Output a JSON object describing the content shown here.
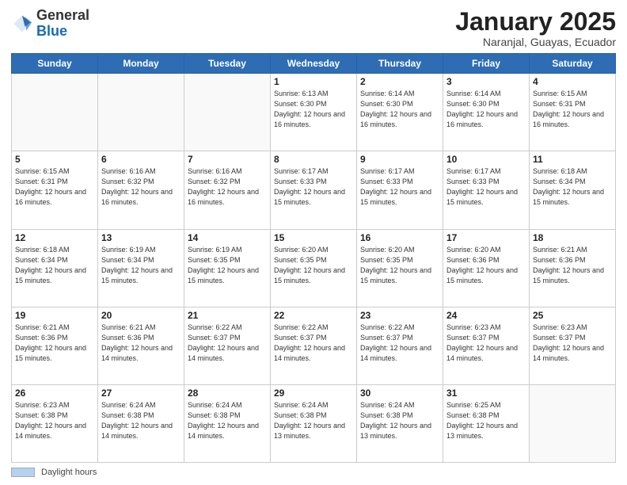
{
  "header": {
    "logo_general": "General",
    "logo_blue": "Blue",
    "month_title": "January 2025",
    "subtitle": "Naranjal, Guayas, Ecuador"
  },
  "days_of_week": [
    "Sunday",
    "Monday",
    "Tuesday",
    "Wednesday",
    "Thursday",
    "Friday",
    "Saturday"
  ],
  "weeks": [
    [
      {
        "day": "",
        "info": ""
      },
      {
        "day": "",
        "info": ""
      },
      {
        "day": "",
        "info": ""
      },
      {
        "day": "1",
        "info": "Sunrise: 6:13 AM\nSunset: 6:30 PM\nDaylight: 12 hours and 16 minutes."
      },
      {
        "day": "2",
        "info": "Sunrise: 6:14 AM\nSunset: 6:30 PM\nDaylight: 12 hours and 16 minutes."
      },
      {
        "day": "3",
        "info": "Sunrise: 6:14 AM\nSunset: 6:30 PM\nDaylight: 12 hours and 16 minutes."
      },
      {
        "day": "4",
        "info": "Sunrise: 6:15 AM\nSunset: 6:31 PM\nDaylight: 12 hours and 16 minutes."
      }
    ],
    [
      {
        "day": "5",
        "info": "Sunrise: 6:15 AM\nSunset: 6:31 PM\nDaylight: 12 hours and 16 minutes."
      },
      {
        "day": "6",
        "info": "Sunrise: 6:16 AM\nSunset: 6:32 PM\nDaylight: 12 hours and 16 minutes."
      },
      {
        "day": "7",
        "info": "Sunrise: 6:16 AM\nSunset: 6:32 PM\nDaylight: 12 hours and 16 minutes."
      },
      {
        "day": "8",
        "info": "Sunrise: 6:17 AM\nSunset: 6:33 PM\nDaylight: 12 hours and 15 minutes."
      },
      {
        "day": "9",
        "info": "Sunrise: 6:17 AM\nSunset: 6:33 PM\nDaylight: 12 hours and 15 minutes."
      },
      {
        "day": "10",
        "info": "Sunrise: 6:17 AM\nSunset: 6:33 PM\nDaylight: 12 hours and 15 minutes."
      },
      {
        "day": "11",
        "info": "Sunrise: 6:18 AM\nSunset: 6:34 PM\nDaylight: 12 hours and 15 minutes."
      }
    ],
    [
      {
        "day": "12",
        "info": "Sunrise: 6:18 AM\nSunset: 6:34 PM\nDaylight: 12 hours and 15 minutes."
      },
      {
        "day": "13",
        "info": "Sunrise: 6:19 AM\nSunset: 6:34 PM\nDaylight: 12 hours and 15 minutes."
      },
      {
        "day": "14",
        "info": "Sunrise: 6:19 AM\nSunset: 6:35 PM\nDaylight: 12 hours and 15 minutes."
      },
      {
        "day": "15",
        "info": "Sunrise: 6:20 AM\nSunset: 6:35 PM\nDaylight: 12 hours and 15 minutes."
      },
      {
        "day": "16",
        "info": "Sunrise: 6:20 AM\nSunset: 6:35 PM\nDaylight: 12 hours and 15 minutes."
      },
      {
        "day": "17",
        "info": "Sunrise: 6:20 AM\nSunset: 6:36 PM\nDaylight: 12 hours and 15 minutes."
      },
      {
        "day": "18",
        "info": "Sunrise: 6:21 AM\nSunset: 6:36 PM\nDaylight: 12 hours and 15 minutes."
      }
    ],
    [
      {
        "day": "19",
        "info": "Sunrise: 6:21 AM\nSunset: 6:36 PM\nDaylight: 12 hours and 15 minutes."
      },
      {
        "day": "20",
        "info": "Sunrise: 6:21 AM\nSunset: 6:36 PM\nDaylight: 12 hours and 14 minutes."
      },
      {
        "day": "21",
        "info": "Sunrise: 6:22 AM\nSunset: 6:37 PM\nDaylight: 12 hours and 14 minutes."
      },
      {
        "day": "22",
        "info": "Sunrise: 6:22 AM\nSunset: 6:37 PM\nDaylight: 12 hours and 14 minutes."
      },
      {
        "day": "23",
        "info": "Sunrise: 6:22 AM\nSunset: 6:37 PM\nDaylight: 12 hours and 14 minutes."
      },
      {
        "day": "24",
        "info": "Sunrise: 6:23 AM\nSunset: 6:37 PM\nDaylight: 12 hours and 14 minutes."
      },
      {
        "day": "25",
        "info": "Sunrise: 6:23 AM\nSunset: 6:37 PM\nDaylight: 12 hours and 14 minutes."
      }
    ],
    [
      {
        "day": "26",
        "info": "Sunrise: 6:23 AM\nSunset: 6:38 PM\nDaylight: 12 hours and 14 minutes."
      },
      {
        "day": "27",
        "info": "Sunrise: 6:24 AM\nSunset: 6:38 PM\nDaylight: 12 hours and 14 minutes."
      },
      {
        "day": "28",
        "info": "Sunrise: 6:24 AM\nSunset: 6:38 PM\nDaylight: 12 hours and 14 minutes."
      },
      {
        "day": "29",
        "info": "Sunrise: 6:24 AM\nSunset: 6:38 PM\nDaylight: 12 hours and 13 minutes."
      },
      {
        "day": "30",
        "info": "Sunrise: 6:24 AM\nSunset: 6:38 PM\nDaylight: 12 hours and 13 minutes."
      },
      {
        "day": "31",
        "info": "Sunrise: 6:25 AM\nSunset: 6:38 PM\nDaylight: 12 hours and 13 minutes."
      },
      {
        "day": "",
        "info": ""
      }
    ]
  ],
  "footer": {
    "legend_label": "Daylight hours"
  }
}
